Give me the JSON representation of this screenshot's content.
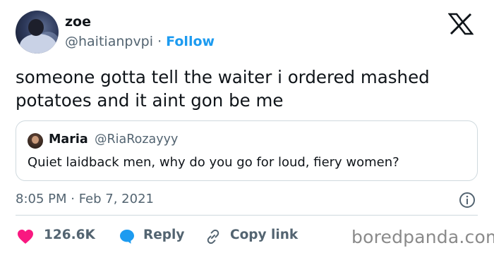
{
  "author": {
    "name": "zoe",
    "handle": "@haitianpvpi",
    "separator": "·",
    "follow_label": "Follow"
  },
  "tweet": {
    "text": "someone gotta tell the waiter i ordered mashed potatoes and it aint gon be me"
  },
  "quoted": {
    "name": "Maria",
    "handle": "@RiaRozayyy",
    "text": "Quiet laidback men, why do you go for loud, fiery women?"
  },
  "meta": {
    "timestamp": "8:05 PM · Feb 7, 2021"
  },
  "actions": {
    "likes": "126.6K",
    "reply_label": "Reply",
    "copy_link_label": "Copy link"
  },
  "watermark": "boredpanda.com",
  "colors": {
    "accent": "#1d9bf0",
    "heart": "#f91880",
    "text": "#0f1419",
    "muted": "#536471",
    "border": "#cfd9de"
  },
  "icons": [
    "x-logo-icon",
    "info-icon",
    "heart-icon",
    "reply-bubble-icon",
    "link-icon"
  ]
}
